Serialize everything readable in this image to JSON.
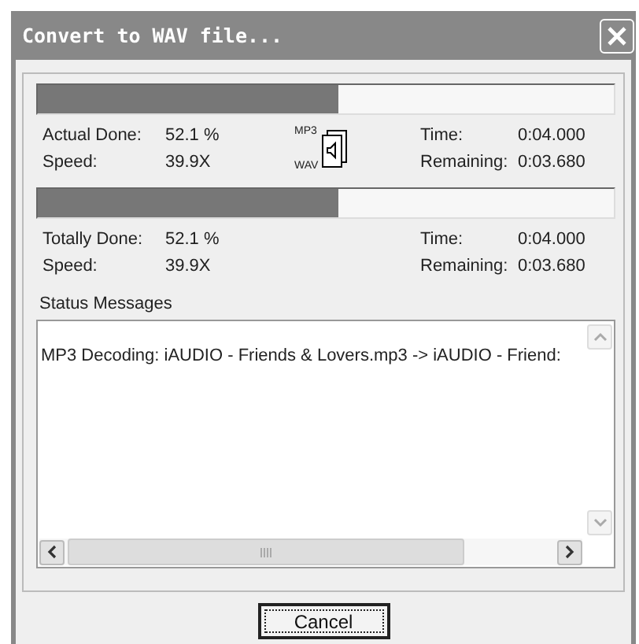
{
  "window": {
    "title": "Convert to WAV file..."
  },
  "progress_groups": [
    {
      "level": 0.521,
      "done_label": "Actual Done:",
      "done_value": "52.1 %",
      "speed_label": "Speed:",
      "speed_value": "39.9X",
      "time_label": "Time:",
      "time_value": "0:04.000",
      "remaining_label": "Remaining:",
      "remaining_value": "0:03.680",
      "icon": {
        "from": "MP3",
        "to": "WAV"
      }
    },
    {
      "level": 0.521,
      "done_label": "Totally Done:",
      "done_value": "52.1 %",
      "speed_label": "Speed:",
      "speed_value": "39.9X",
      "time_label": "Time:",
      "time_value": "0:04.000",
      "remaining_label": "Remaining:",
      "remaining_value": "0:03.680"
    }
  ],
  "status_messages": {
    "label": "Status Messages",
    "lines": [
      "MP3 Decoding: iAUDIO - Friends & Lovers.mp3  -> iAUDIO - Friend:"
    ]
  },
  "buttons": [
    "Cancel"
  ]
}
